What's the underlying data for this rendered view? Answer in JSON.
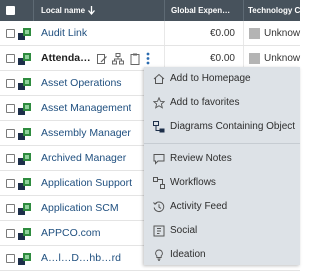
{
  "table": {
    "columns": {
      "local_name": "Local name",
      "sort_icon": "arrow-down-icon",
      "global_expenses": "Global Expen…",
      "technology": "Technology Co"
    },
    "rows": [
      {
        "name": "Audit Link",
        "expense": "€0.00",
        "tech": "Unknow"
      },
      {
        "name": "Attenda…",
        "expense": "€0.00",
        "tech": "Unknow"
      },
      {
        "name": "Asset Operations"
      },
      {
        "name": "Asset Management"
      },
      {
        "name": "Assembly Manager"
      },
      {
        "name": "Archived Manager"
      },
      {
        "name": "Application Support"
      },
      {
        "name": "Application SCM"
      },
      {
        "name": "APPCO.com"
      },
      {
        "name": "A…l…D…hb…rd"
      }
    ]
  },
  "context_menu": {
    "items": [
      {
        "label": "Add to Homepage",
        "icon": "home-icon"
      },
      {
        "label": "Add to favorites",
        "icon": "star-icon"
      },
      {
        "label": "Diagrams Containing Object",
        "icon": "diagram-icon"
      },
      {
        "label": "Review Notes",
        "icon": "comment-icon"
      },
      {
        "label": "Workflows",
        "icon": "workflow-icon"
      },
      {
        "label": "Activity Feed",
        "icon": "history-icon"
      },
      {
        "label": "Social",
        "icon": "social-icon"
      },
      {
        "label": "Ideation",
        "icon": "lightbulb-icon"
      }
    ]
  },
  "colors": {
    "header_bg": "#47525c",
    "menu_bg": "#dde2e7",
    "app_icon_green": "#2e8b3e",
    "app_icon_dark": "#1d2f4a",
    "link_text": "#1f4f7f"
  }
}
